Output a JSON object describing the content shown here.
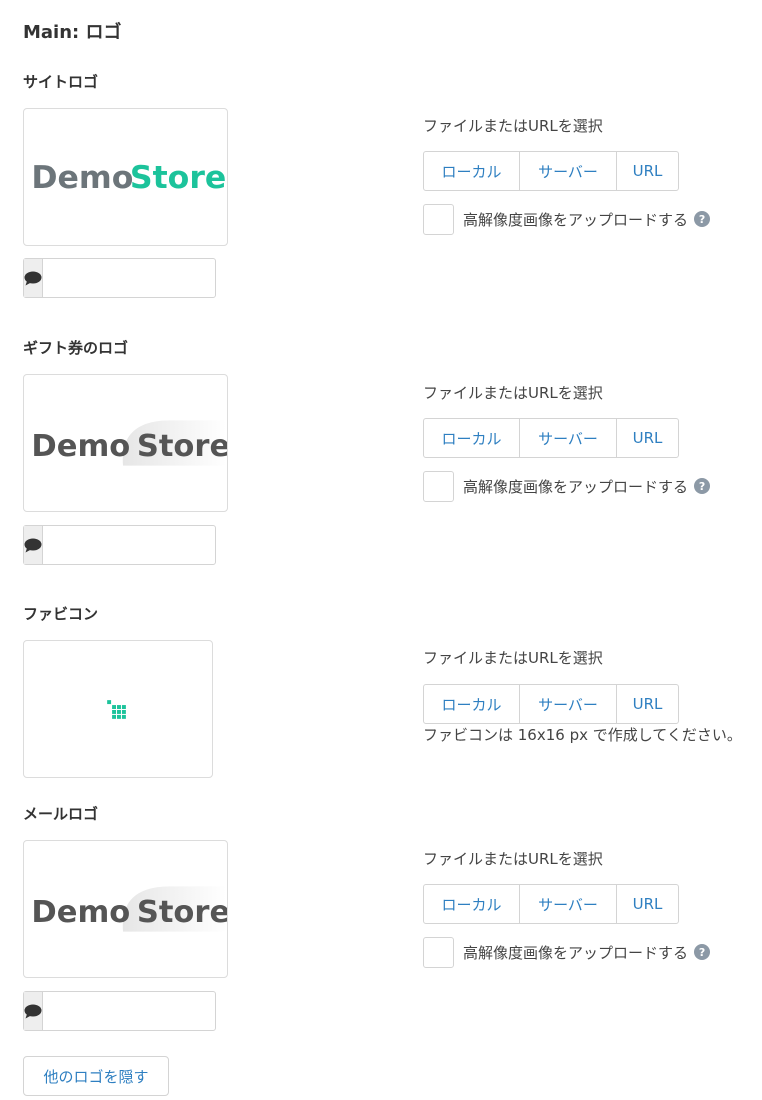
{
  "page": {
    "title": "Main: ロゴ"
  },
  "sections": [
    {
      "title": "サイトロゴ",
      "file_label": "ファイルまたはURLを選択",
      "local": "ローカル",
      "server": "サーバー",
      "url": "URL",
      "hidpi_label": "高解像度画像をアップロードする",
      "logo_word1": "Demo",
      "logo_word2": "Store"
    },
    {
      "title": "ギフト券のロゴ",
      "file_label": "ファイルまたはURLを選択",
      "local": "ローカル",
      "server": "サーバー",
      "url": "URL",
      "hidpi_label": "高解像度画像をアップロードする",
      "logo_word1": "Demo",
      "logo_word2": "Store"
    },
    {
      "title": "ファビコン",
      "file_label": "ファイルまたはURLを選択",
      "local": "ローカル",
      "server": "サーバー",
      "url": "URL",
      "note": "ファビコンは 16x16 px で作成してください。"
    },
    {
      "title": "メールロゴ",
      "file_label": "ファイルまたはURLを選択",
      "local": "ローカル",
      "server": "サーバー",
      "url": "URL",
      "hidpi_label": "高解像度画像をアップロードする",
      "logo_word1": "Demo",
      "logo_word2": "Store"
    }
  ],
  "hide_button": {
    "label": "他のロゴを隠す"
  },
  "icons": {
    "comment": "comment-icon",
    "help": "question-circle-icon",
    "help_glyph": "?"
  },
  "colors": {
    "accent": "#2e7fc1",
    "brand_teal": "#1cc39b",
    "logo_gray": "#6c757a",
    "logo_dark": "#555555"
  }
}
